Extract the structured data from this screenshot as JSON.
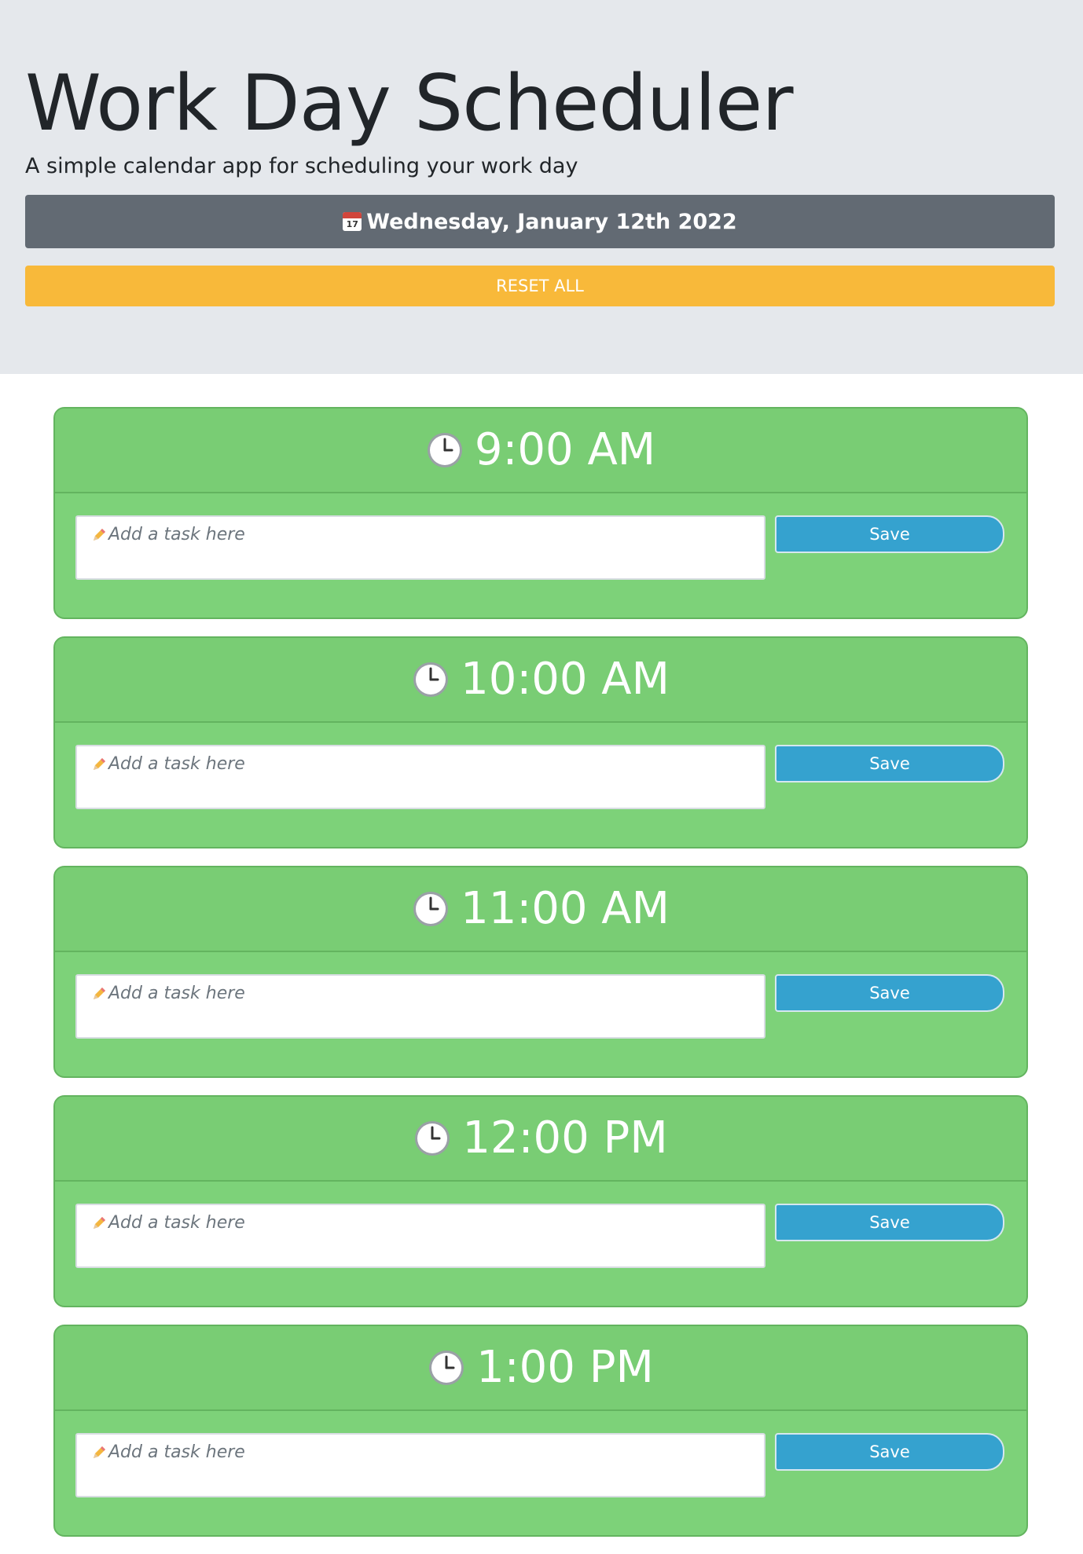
{
  "header": {
    "title": "Work Day Scheduler",
    "subtitle": "A simple calendar app for scheduling your work day",
    "date": "Wednesday, January 12th 2022",
    "calendar_icon_day": "17",
    "reset_label": "RESET ALL"
  },
  "slots": [
    {
      "time": "9:00 AM",
      "placeholder": "Add a task here",
      "save_label": "Save"
    },
    {
      "time": "10:00 AM",
      "placeholder": "Add a task here",
      "save_label": "Save"
    },
    {
      "time": "11:00 AM",
      "placeholder": "Add a task here",
      "save_label": "Save"
    },
    {
      "time": "12:00 PM",
      "placeholder": "Add a task here",
      "save_label": "Save"
    },
    {
      "time": "1:00 PM",
      "placeholder": "Add a task here",
      "save_label": "Save"
    }
  ],
  "icons": {
    "date": "calendar-icon",
    "slot": "clock-icon",
    "input": "pencil-icon"
  },
  "colors": {
    "header_bg": "#e5e8ec",
    "date_bar": "#626a73",
    "reset": "#f8b93a",
    "slot_bg": "#7dd279",
    "save": "#35a2cf"
  }
}
